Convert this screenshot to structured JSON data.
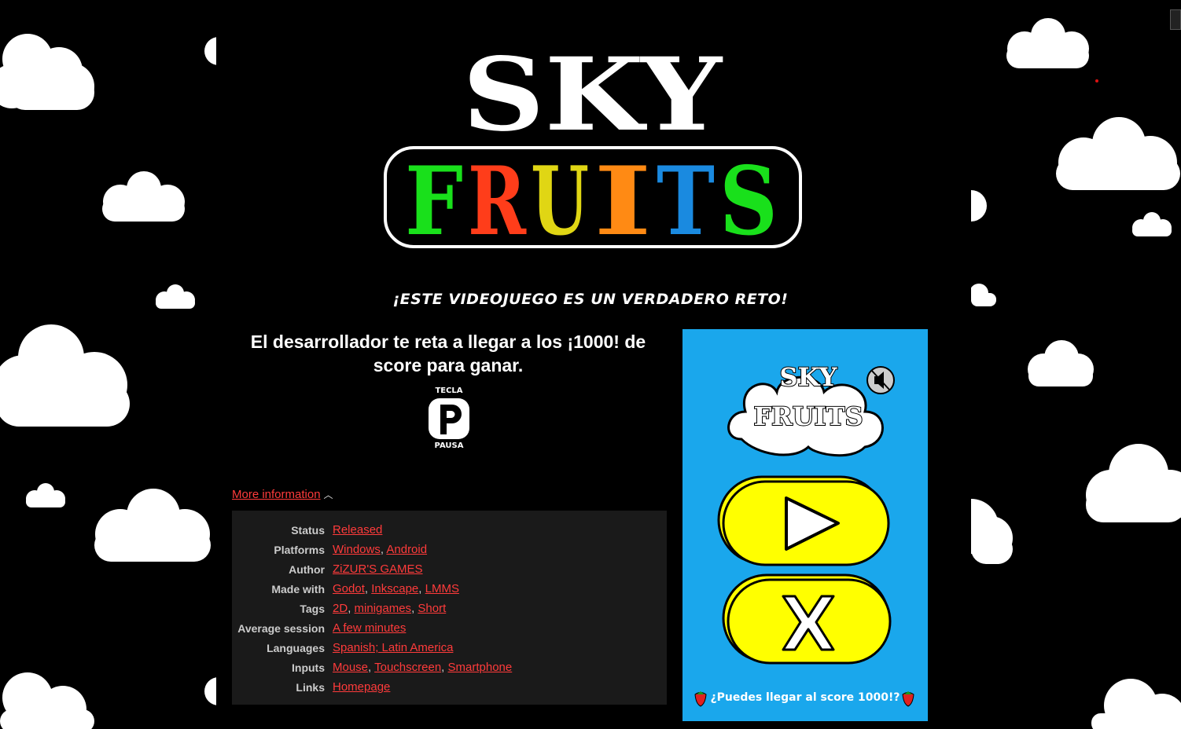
{
  "logo": {
    "line1": "SKY",
    "line2": [
      "F",
      "R",
      "U",
      "I",
      "T",
      "S"
    ],
    "line2_colors": [
      "#19e01b",
      "#ff3d1a",
      "#e0d614",
      "#ff8a14",
      "#1a8ae0",
      "#19e01b"
    ]
  },
  "tagline": "¡ESTE VIDEOJUEGO ES UN VERDADERO RETO!",
  "challenge": "El desarrollador te reta a llegar a los ¡1000! de score para ganar.",
  "pause_hint": {
    "top": "TECLA",
    "key": "P",
    "bottom": "PAUSA"
  },
  "more_info": {
    "label": "More information",
    "chevron": "^"
  },
  "info": [
    {
      "key": "Status",
      "values": [
        "Released"
      ]
    },
    {
      "key": "Platforms",
      "values": [
        "Windows",
        "Android"
      ]
    },
    {
      "key": "Author",
      "values": [
        "ZiZUR'S GAMES"
      ]
    },
    {
      "key": "Made with",
      "values": [
        "Godot",
        "Inkscape",
        "LMMS"
      ]
    },
    {
      "key": "Tags",
      "values": [
        "2D",
        "minigames",
        "Short"
      ]
    },
    {
      "key": "Average session",
      "values": [
        "A few minutes"
      ]
    },
    {
      "key": "Languages",
      "values": [
        "Spanish; Latin America"
      ]
    },
    {
      "key": "Inputs",
      "values": [
        "Mouse",
        "Touchscreen",
        "Smartphone"
      ]
    },
    {
      "key": "Links",
      "values": [
        "Homepage"
      ]
    }
  ],
  "game": {
    "logo_line1": "SKY",
    "logo_line2": "FRUITS",
    "score_prompt": "¿Puedes llegar al score 1000!?",
    "play_icon": "play-icon",
    "exit_icon": "close-icon",
    "sound_icon": "speaker-muted-icon"
  },
  "colors": {
    "link": "#ff3b3b",
    "game_bg": "#1aa7ec",
    "button_yellow": "#ffff00"
  }
}
